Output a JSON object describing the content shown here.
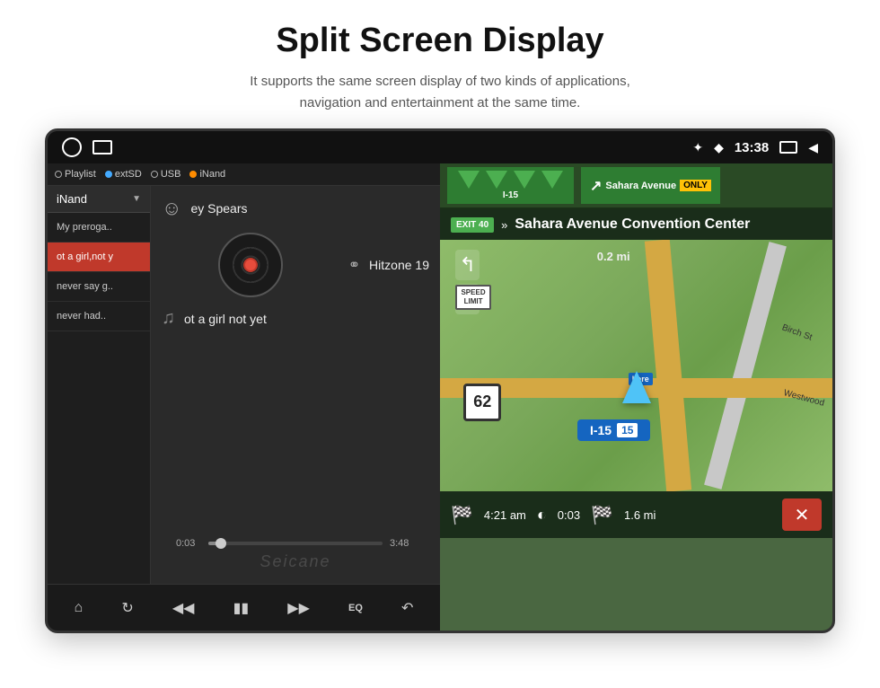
{
  "header": {
    "title": "Split Screen Display",
    "subtitle": "It supports the same screen display of two kinds of applications,\nnavigation and entertainment at the same time."
  },
  "status_bar": {
    "time": "13:38",
    "icons": [
      "circle",
      "image",
      "bluetooth",
      "location",
      "screen",
      "back"
    ]
  },
  "music_player": {
    "source_tabs": [
      "Playlist",
      "extSD",
      "USB",
      "iNand"
    ],
    "source_active": "iNand",
    "playlist_header": "iNand",
    "playlist_items": [
      {
        "label": "My preroga..",
        "active": false
      },
      {
        "label": "ot a girl,not y",
        "active": true
      },
      {
        "label": "never say g..",
        "active": false
      },
      {
        "label": "never had..",
        "active": false
      }
    ],
    "now_playing": {
      "artist": "ey Spears",
      "album": "Hitzone 19",
      "track": "ot a girl not yet"
    },
    "progress": {
      "current": "0:03",
      "total": "3:48",
      "percent": 7
    },
    "watermark": "Seicane",
    "transport_buttons": [
      "home",
      "repeat",
      "prev",
      "play",
      "next",
      "eq",
      "back"
    ]
  },
  "navigation": {
    "exit_number": "EXIT 40",
    "destination": "Sahara Avenue Convention Center",
    "distance": "0.2 mi",
    "highway": "I-15",
    "highway_shield": "15",
    "speed_limit": "62",
    "road_label_1": "Birch St",
    "road_label_2": "Westwood",
    "eta": "4:21 am",
    "elapsed": "0:03",
    "remaining_dist": "1.6 mi"
  }
}
